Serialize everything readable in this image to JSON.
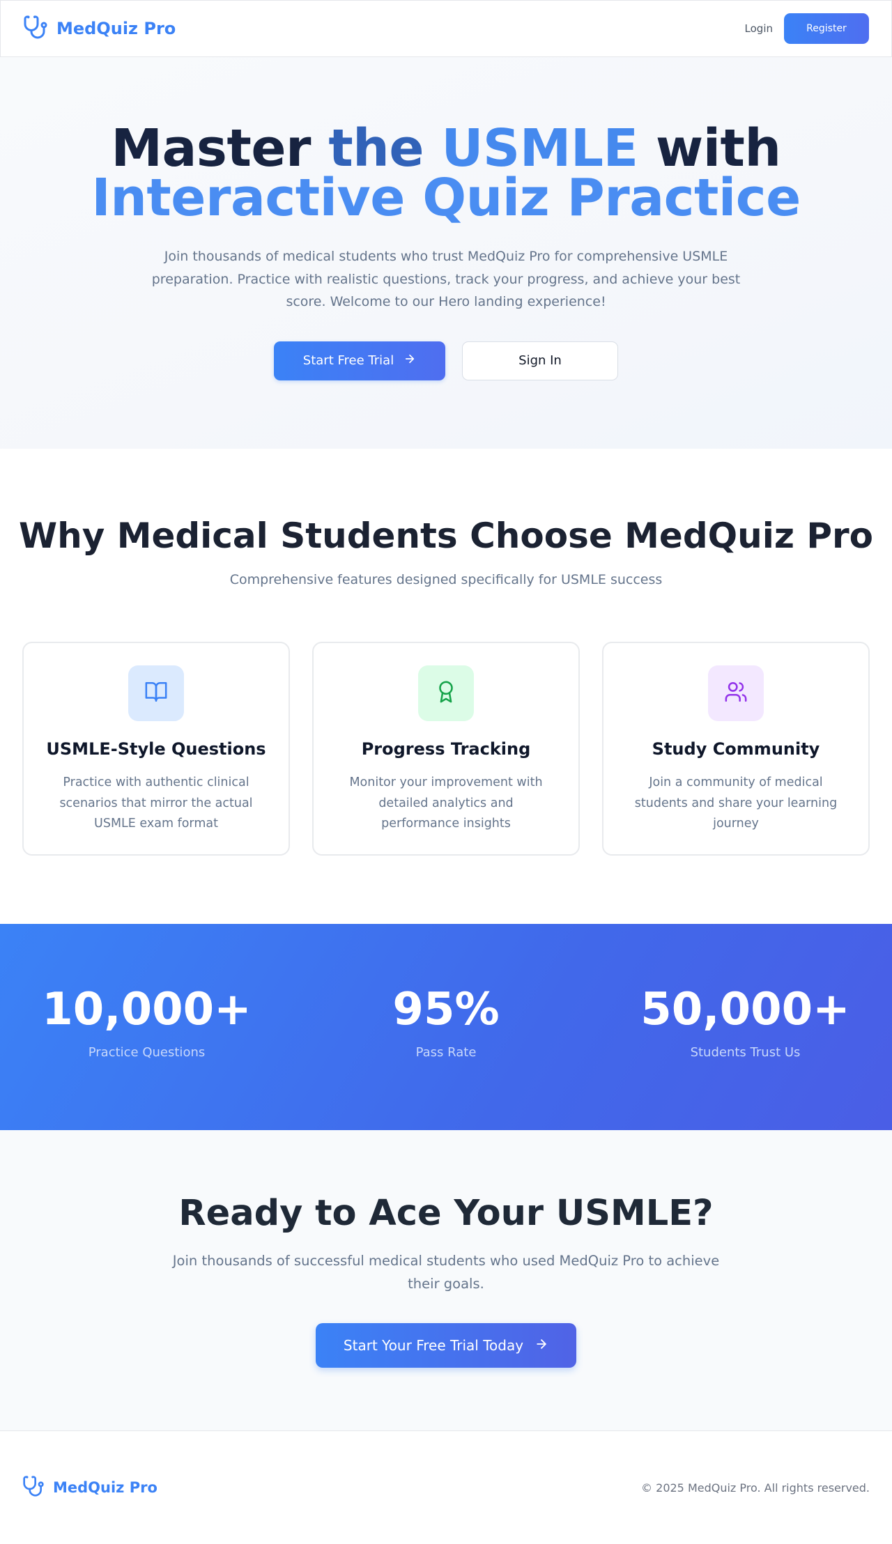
{
  "header": {
    "brand": "MedQuiz Pro",
    "login_label": "Login",
    "register_label": "Register"
  },
  "hero": {
    "title_line1": {
      "part1": "Master",
      "part2": "the",
      "part3": "USMLE",
      "part4": "with"
    },
    "title_line2": "Interactive Quiz Practice",
    "subtitle": "Join thousands of medical students who trust MedQuiz Pro for comprehensive USMLE preparation. Practice with realistic questions, track your progress, and achieve your best score. Welcome to our Hero landing experience!",
    "primary_cta": "Start Free Trial",
    "secondary_cta": "Sign In"
  },
  "features": {
    "title": "Why Medical Students Choose MedQuiz Pro",
    "subtitle": "Comprehensive features designed specifically for USMLE success",
    "cards": [
      {
        "icon": "book-open-icon",
        "title": "USMLE-Style Questions",
        "description": "Practice with authentic clinical scenarios that mirror the actual USMLE exam format",
        "accent": "#3b82f6",
        "bg": "#dbeafe"
      },
      {
        "icon": "award-icon",
        "title": "Progress Tracking",
        "description": "Monitor your improvement with detailed analytics and performance insights",
        "accent": "#16a34a",
        "bg": "#dcfce7"
      },
      {
        "icon": "users-icon",
        "title": "Study Community",
        "description": "Join a community of medical students and share your learning journey",
        "accent": "#9333ea",
        "bg": "#f3e8ff"
      }
    ]
  },
  "stats": [
    {
      "value": "10,000+",
      "label": "Practice Questions"
    },
    {
      "value": "95%",
      "label": "Pass Rate"
    },
    {
      "value": "50,000+",
      "label": "Students Trust Us"
    }
  ],
  "cta": {
    "title": "Ready to Ace Your USMLE?",
    "subtitle": "Join thousands of successful medical students who used MedQuiz Pro to achieve their goals.",
    "button": "Start Your Free Trial Today"
  },
  "footer": {
    "brand": "MedQuiz Pro",
    "copyright": "© 2025 MedQuiz Pro. All rights reserved."
  },
  "colors": {
    "brand": "#3b82f6",
    "heading_dark": "#1b2232",
    "muted_text": "#64748b"
  }
}
